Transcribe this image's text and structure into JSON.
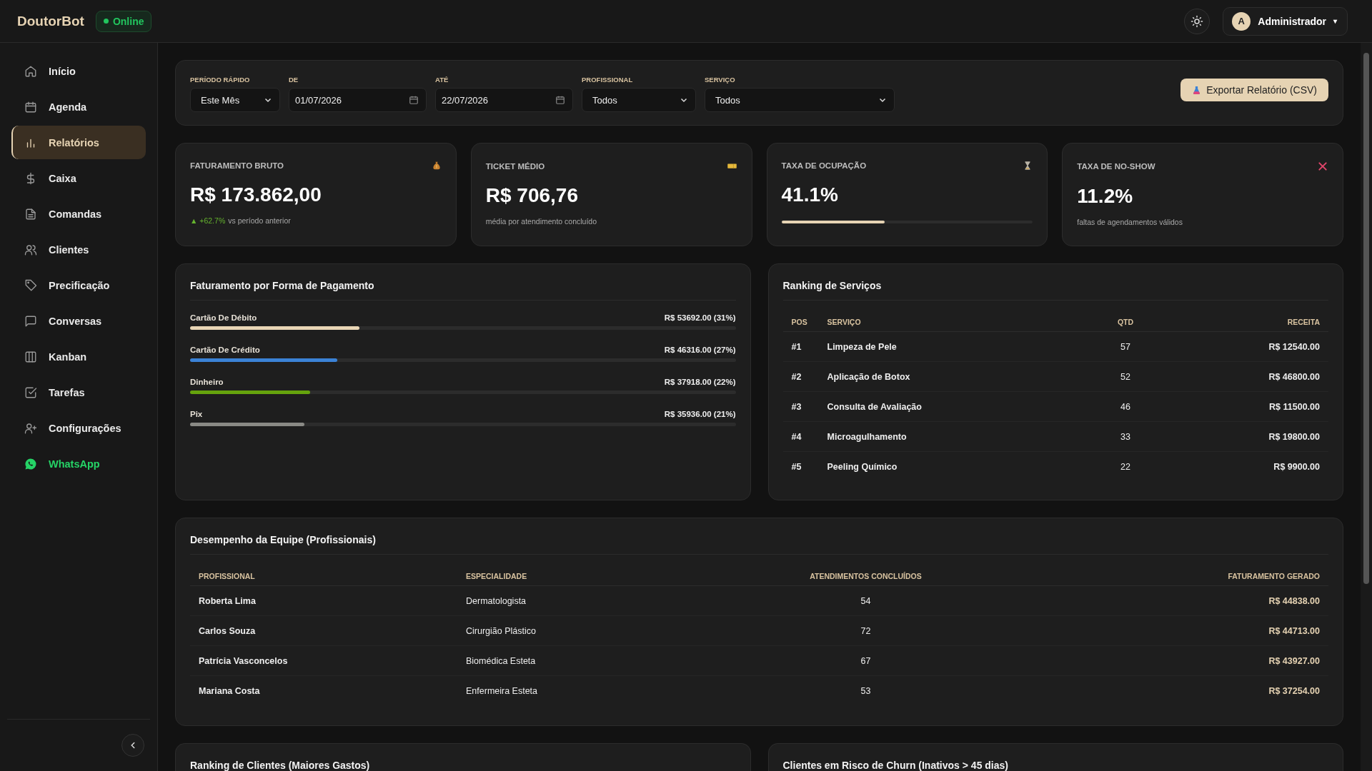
{
  "app": {
    "brand": "DoutorBot",
    "status": "Online",
    "user_initial": "A",
    "user_name": "Administrador",
    "user_caret": "▾"
  },
  "sidebar": {
    "items": [
      {
        "label": "Início",
        "kind": "nav",
        "selected": false
      },
      {
        "label": "Agenda",
        "kind": "nav",
        "selected": false
      },
      {
        "label": "Relatórios",
        "kind": "nav",
        "selected": true
      },
      {
        "label": "Caixa",
        "kind": "nav",
        "selected": false
      },
      {
        "label": "Comandas",
        "kind": "nav",
        "selected": false
      },
      {
        "label": "Clientes",
        "kind": "nav",
        "selected": false
      },
      {
        "label": "Precificação",
        "kind": "nav",
        "selected": false
      },
      {
        "label": "Conversas",
        "kind": "nav",
        "selected": false
      },
      {
        "label": "Kanban",
        "kind": "nav",
        "selected": false
      },
      {
        "label": "Tarefas",
        "kind": "nav",
        "selected": false
      },
      {
        "label": "Configurações",
        "kind": "nav",
        "selected": false
      },
      {
        "label": "WhatsApp",
        "kind": "whatsapp",
        "selected": false
      }
    ]
  },
  "filters": {
    "fields": [
      {
        "label": "PERÍODO RÁPIDO",
        "value": "Este Mês",
        "kind": "select"
      },
      {
        "label": "DE",
        "value": "01/07/2026",
        "kind": "date"
      },
      {
        "label": "ATÉ",
        "value": "22/07/2026",
        "kind": "date"
      },
      {
        "label": "PROFISSIONAL",
        "value": "Todos",
        "kind": "select"
      },
      {
        "label": "SERVIÇO",
        "value": "Todos",
        "kind": "select"
      }
    ],
    "export_button": "Exportar Relatório (CSV)"
  },
  "kpis": [
    {
      "title": "FATURAMENTO BRUTO",
      "value": "R$ 173.862,00",
      "kind": "trend",
      "trend": "▲ +62.7%",
      "note": "vs período anterior"
    },
    {
      "title": "TICKET MÉDIO",
      "value": "R$ 706,76",
      "kind": "note",
      "note": "média por atendimento concluído"
    },
    {
      "title": "TAXA DE OCUPAÇÃO",
      "value": "41.1%",
      "kind": "meter",
      "level": 0.411
    },
    {
      "title": "TAXA DE NO-SHOW",
      "value": "11.2%",
      "kind": "note",
      "note": "faltas de agendamentos válidos"
    }
  ],
  "payments": {
    "title": "Faturamento por Forma de Pagamento",
    "items": [
      {
        "label": "Cartão De Débito",
        "amount": "R$ 53692.00 (31%)",
        "level": 0.31,
        "color": "#e8d5b5"
      },
      {
        "label": "Cartão De Crédito",
        "amount": "R$ 46316.00 (27%)",
        "level": 0.27,
        "color": "#3b82d6"
      },
      {
        "label": "Dinheiro",
        "amount": "R$ 37918.00 (22%)",
        "level": 0.22,
        "color": "#65a30d"
      },
      {
        "label": "Pix",
        "amount": "R$ 35936.00 (21%)",
        "level": 0.21,
        "color": "#8a8a85"
      }
    ]
  },
  "services": {
    "title": "Ranking de Serviços",
    "columns": [
      "POS",
      "SERVIÇO",
      "QTD",
      "RECEITA"
    ],
    "rows": [
      [
        "#1",
        "Limpeza de Pele",
        "57",
        "R$ 12540.00"
      ],
      [
        "#2",
        "Aplicação de Botox",
        "52",
        "R$ 46800.00"
      ],
      [
        "#3",
        "Consulta de Avaliação",
        "46",
        "R$ 11500.00"
      ],
      [
        "#4",
        "Microagulhamento",
        "33",
        "R$ 19800.00"
      ],
      [
        "#5",
        "Peeling Químico",
        "22",
        "R$ 9900.00"
      ]
    ]
  },
  "team": {
    "title": "Desempenho da Equipe (Profissionais)",
    "columns": [
      "PROFISSIONAL",
      "ESPECIALIDADE",
      "ATENDIMENTOS CONCLUÍDOS",
      "FATURAMENTO GERADO"
    ],
    "rows": [
      [
        "Roberta Lima",
        "Dermatologista",
        "54",
        "R$ 44838.00"
      ],
      [
        "Carlos Souza",
        "Cirurgião Plástico",
        "72",
        "R$ 44713.00"
      ],
      [
        "Patrícia Vasconcelos",
        "Biomédica Esteta",
        "67",
        "R$ 43927.00"
      ],
      [
        "Mariana Costa",
        "Enfermeira Esteta",
        "53",
        "R$ 37254.00"
      ]
    ]
  },
  "bottom_panels": [
    {
      "title": "Ranking de Clientes (Maiores Gastos)"
    },
    {
      "title": "Clientes em Risco de Churn (Inativos > 45 dias)"
    }
  ]
}
